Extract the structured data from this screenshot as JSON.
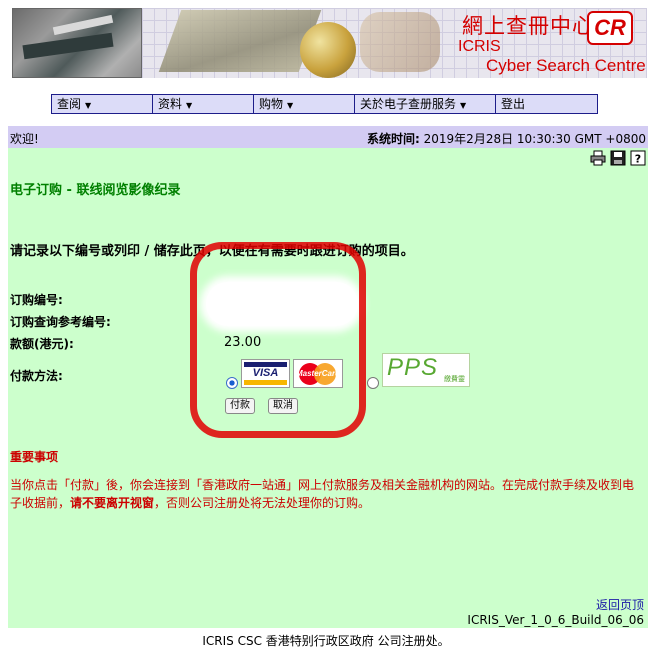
{
  "banner": {
    "title_cn": "網上查冊中心",
    "title_icris": "ICRIS",
    "title_csc": "Cyber Search Centre",
    "logo_text": "CR"
  },
  "nav": {
    "items": [
      {
        "label": "查阅",
        "has_menu": true
      },
      {
        "label": "资料",
        "has_menu": true
      },
      {
        "label": "购物",
        "has_menu": true
      },
      {
        "label": "关於电子查册服务",
        "has_menu": true
      },
      {
        "label": "登出",
        "has_menu": false
      }
    ],
    "caret": "▼"
  },
  "status": {
    "welcome": "欢迎!",
    "time_label": "系统时间:",
    "time_value": "2019年2月28日 10:30:30 GMT +0800"
  },
  "tools": [
    "printer-icon",
    "save-icon",
    "help-icon"
  ],
  "page": {
    "title": "电子订购 - 联线阅览影像纪录",
    "instruction": "请记录以下编号或列印 / 储存此页，以便在有需要时跟进订购的项目。",
    "order_no_label": "订购编号:",
    "order_ref_label": "订购查询参考编号:",
    "amount_label": "款额(港元):",
    "amount_value": "23.00",
    "method_label": "付款方法:",
    "payment_methods": [
      {
        "name": "VISA",
        "selected": true
      },
      {
        "name": "MasterCard",
        "selected": true
      },
      {
        "name": "PPS",
        "sub": "繳費靈",
        "selected": false
      }
    ],
    "pay_button": "付款",
    "cancel_button": "取消"
  },
  "notice": {
    "title": "重要事项",
    "body_1": "当你点击「付款」後，你会连接到「香港政府一站通」网上付款服务及相关金融机构的网站。在完成付款手续及收到电子收据前，",
    "body_bold": "请不要离开视窗",
    "body_2": "，否则公司注册处将无法处理你的订购。"
  },
  "footer": {
    "back_link": "返回页顶",
    "version": "ICRIS_Ver_1_0_6_Build_06_06",
    "copyright": "ICRIS CSC 香港特别行政区政府 公司注册处。"
  },
  "colors": {
    "nav_bg": "#dcdcf8",
    "status_bg": "#d3ccf3",
    "content_bg": "#ccffcc",
    "title_green": "#008000",
    "notice_red": "#cc0000",
    "link_blue": "#1a1aa6"
  }
}
